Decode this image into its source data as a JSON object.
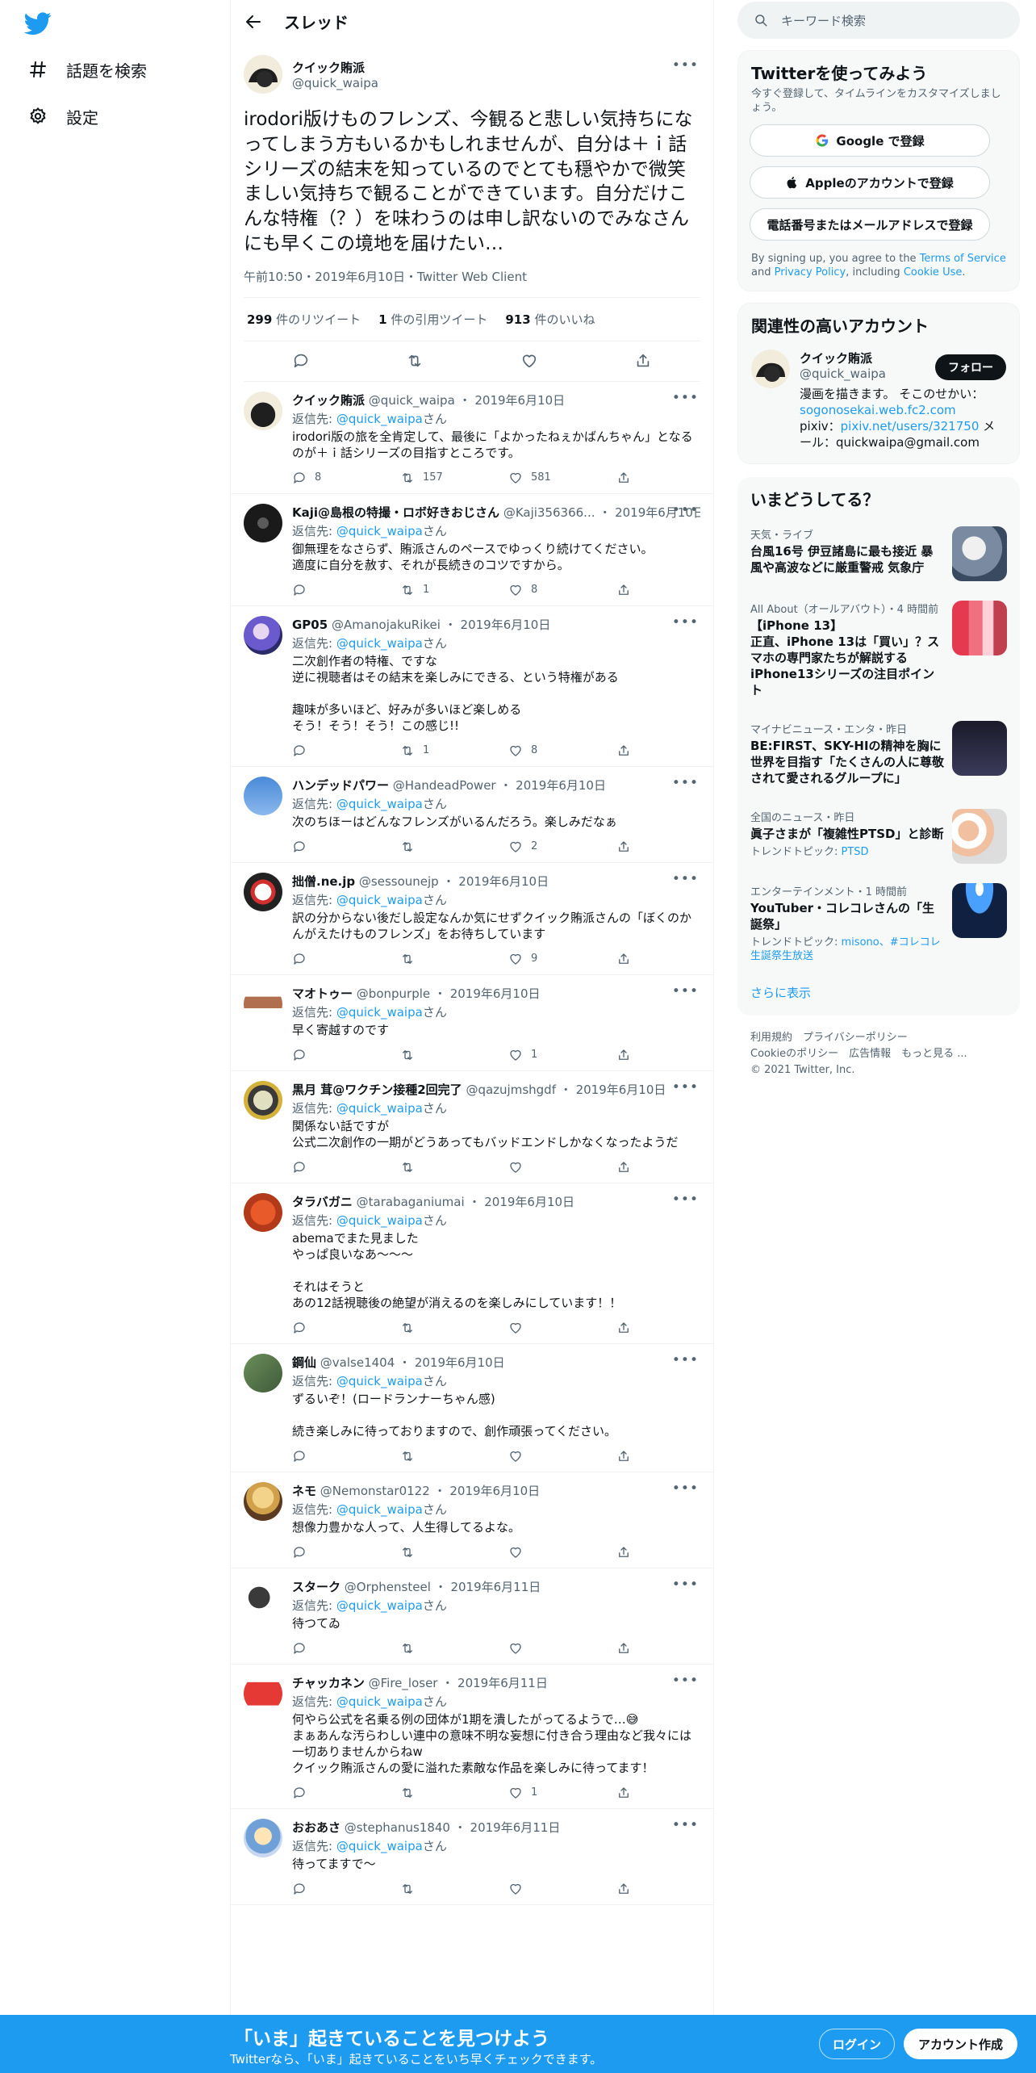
{
  "nav": {
    "explore_label": "話題を検索",
    "settings_label": "設定"
  },
  "header": {
    "title": "スレッド"
  },
  "main_tweet": {
    "name": "クイック賄派",
    "handle": "@quick_waipa",
    "text": "irodori版けものフレンズ、今観ると悲しい気持ちになってしまう方もいるかもしれませんが、自分は＋ｉ話シリーズの結末を知っているのでとても穏やかで微笑ましい気持ちで観ることができています。自分だけこんな特権（？）を味わうのは申し訳ないのでみなさんにも早くこの境地を届けたい…",
    "meta": "午前10:50・2019年6月10日・Twitter Web Client",
    "retweets": "299",
    "retweets_label": "件のリツイート",
    "quotes": "1",
    "quotes_label": "件の引用ツイート",
    "likes": "913",
    "likes_label": "件のいいね"
  },
  "replies": [
    {
      "name": "クイック賄派",
      "handle": "@quick_waipa",
      "date": "2019年6月10日",
      "replyto_label": "返信先:",
      "replyto": "@quick_waipa",
      "replyto_suffix": "さん",
      "text": "irodori版の旅を全肯定して、最後に「よかったねぇかばんちゃん」となるのが＋ｉ話シリーズの目指すところです。",
      "replies": "8",
      "retweets": "157",
      "likes": "581"
    },
    {
      "name": "Kaji@島根の特撮・ロボ好きおじさん",
      "handle": "@Kaji356366...",
      "date": "2019年6月10日",
      "replyto_label": "返信先:",
      "replyto": "@quick_waipa",
      "replyto_suffix": "さん",
      "text": "御無理をなさらず、賄派さんのペースでゆっくり続けてください。\n適度に自分を赦す、それが長続きのコツですから。",
      "replies": "",
      "retweets": "1",
      "likes": "8"
    },
    {
      "name": "GP05",
      "handle": "@AmanojakuRikei",
      "date": "2019年6月10日",
      "replyto_label": "返信先:",
      "replyto": "@quick_waipa",
      "replyto_suffix": "さん",
      "text": "二次創作者の特権、ですな\n逆に視聴者はその結末を楽しみにできる、という特権がある\n\n趣味が多いほど、好みが多いほど楽しめる\nそう！そう！そう！この感じ!!",
      "replies": "",
      "retweets": "1",
      "likes": "8"
    },
    {
      "name": "ハンデッドパワー",
      "handle": "@HandeadPower",
      "date": "2019年6月10日",
      "replyto_label": "返信先:",
      "replyto": "@quick_waipa",
      "replyto_suffix": "さん",
      "text": "次のちほーはどんなフレンズがいるんだろう。楽しみだなぁ",
      "replies": "",
      "retweets": "",
      "likes": "2"
    },
    {
      "name": "拙僧.ne.jp",
      "handle": "@sessounejp",
      "date": "2019年6月10日",
      "replyto_label": "返信先:",
      "replyto": "@quick_waipa",
      "replyto_suffix": "さん",
      "text": "訳の分からない後だし設定なんか気にせずクイック賄派さんの「ぼくのかんがえたけものフレンズ」をお待ちしています",
      "replies": "",
      "retweets": "",
      "likes": "9"
    },
    {
      "name": "マオトゥー",
      "handle": "@bonpurple",
      "date": "2019年6月10日",
      "replyto_label": "返信先:",
      "replyto": "@quick_waipa",
      "replyto_suffix": "さん",
      "text": "早く寄越すのです",
      "replies": "",
      "retweets": "",
      "likes": "1"
    },
    {
      "name": "黒月 茸@ワクチン接種2回完了",
      "handle": "@qazujmshgdf",
      "date": "2019年6月10日",
      "replyto_label": "返信先:",
      "replyto": "@quick_waipa",
      "replyto_suffix": "さん",
      "text": "関係ない話ですが\n公式二次創作の一期がどうあってもバッドエンドしかなくなったようだ",
      "replies": "",
      "retweets": "",
      "likes": ""
    },
    {
      "name": "タラバガニ",
      "handle": "@tarabaganiumai",
      "date": "2019年6月10日",
      "replyto_label": "返信先:",
      "replyto": "@quick_waipa",
      "replyto_suffix": "さん",
      "text": "abemaでまた見ました\nやっぱ良いなあ～～～\n\nそれはそうと\nあの12話視聴後の絶望が消えるのを楽しみにしています！！",
      "replies": "",
      "retweets": "",
      "likes": ""
    },
    {
      "name": "鋼仙",
      "handle": "@valse1404",
      "date": "2019年6月10日",
      "replyto_label": "返信先:",
      "replyto": "@quick_waipa",
      "replyto_suffix": "さん",
      "text": "ずるいぞ！(ロードランナーちゃん感)\n\n続き楽しみに待っておりますので、創作頑張ってください。",
      "replies": "",
      "retweets": "",
      "likes": ""
    },
    {
      "name": "ネモ",
      "handle": "@Nemonstar0122",
      "date": "2019年6月10日",
      "replyto_label": "返信先:",
      "replyto": "@quick_waipa",
      "replyto_suffix": "さん",
      "text": "想像力豊かな人って、人生得してるよな。",
      "replies": "",
      "retweets": "",
      "likes": ""
    },
    {
      "name": "スターク",
      "handle": "@Orphensteel",
      "date": "2019年6月11日",
      "replyto_label": "返信先:",
      "replyto": "@quick_waipa",
      "replyto_suffix": "さん",
      "text": "待つてゐ",
      "replies": "",
      "retweets": "",
      "likes": ""
    },
    {
      "name": "チャッカネン",
      "handle": "@Fire_loser",
      "date": "2019年6月11日",
      "replyto_label": "返信先:",
      "replyto": "@quick_waipa",
      "replyto_suffix": "さん",
      "text": "何やら公式を名乗る例の団体が1期を潰したがってるようで…😅\nまぁあんな汚らわしい連中の意味不明な妄想に付き合う理由など我々には一切ありませんからねw\nクイック賄派さんの愛に溢れた素敵な作品を楽しみに待ってます！",
      "replies": "",
      "retweets": "",
      "likes": "1"
    },
    {
      "name": "おおあさ",
      "handle": "@stephanus1840",
      "date": "2019年6月11日",
      "replyto_label": "返信先:",
      "replyto": "@quick_waipa",
      "replyto_suffix": "さん",
      "text": "待ってますで～",
      "replies": "",
      "retweets": "",
      "likes": ""
    }
  ],
  "search": {
    "placeholder": "キーワード検索"
  },
  "signup_card": {
    "title": "Twitterを使ってみよう",
    "subtitle": "今すぐ登録して、タイムラインをカスタマイズしましょう。",
    "google_label": "Google で登録",
    "apple_label": "Appleのアカウントで登録",
    "phone_label": "電話番号またはメールアドレスで登録",
    "terms_pre": "By signing up, you agree to the ",
    "terms_tos": "Terms of Service",
    "terms_and": " and ",
    "terms_privacy": "Privacy Policy",
    "terms_including": ", including ",
    "terms_cookie": "Cookie Use",
    "terms_end": "."
  },
  "related": {
    "title": "関連性の高いアカウント",
    "name": "クイック賄派",
    "handle": "@quick_waipa",
    "follow_label": "フォロー",
    "bio_1": "漫画を描きます。 そこのせかい：",
    "bio_link1": "sogonosekai.web.fc2.com",
    "bio_2": "pixiv：",
    "bio_link2": "pixiv.net/users/321750",
    "bio_3": " メール：quickwaipa@gmail.com"
  },
  "trends": {
    "title": "いまどうしてる？",
    "items": [
      {
        "meta": "天気・ライブ",
        "title": "台風16号 伊豆諸島に最も接近 暴風や高波などに厳重警戒 気象庁",
        "topic_label": "",
        "topic": ""
      },
      {
        "meta": "All About（オールアバウト）・4 時間前",
        "title": "【iPhone 13】\n正直、iPhone 13は「買い」？スマホの専門家たちが解説するiPhone13シリーズの注目ポイント",
        "topic_label": "",
        "topic": ""
      },
      {
        "meta": "マイナビニュース・エンタ・昨日",
        "title": "BE:FIRST、SKY-HIの精神を胸に世界を目指す「たくさんの人に尊敬されて愛されるグループに」",
        "topic_label": "",
        "topic": ""
      },
      {
        "meta": "全国のニュース・昨日",
        "title": "眞子さまが「複雑性PTSD」と診断",
        "topic_label": "トレンドトピック: ",
        "topic": "PTSD"
      },
      {
        "meta": "エンターテインメント・1 時間前",
        "title": "YouTuber・コレコレさんの「生誕祭」",
        "topic_label": "トレンドトピック: ",
        "topic": "misono、#コレコレ生誕祭生放送"
      }
    ],
    "show_more": "さらに表示"
  },
  "footer": {
    "line1": "利用規約　プライバシーポリシー",
    "line2": "Cookieのポリシー　広告情報　もっと見る ...",
    "line3": "© 2021 Twitter, Inc."
  },
  "bottom": {
    "headline": "「いま」起きていることを見つけよう",
    "subline": "Twitterなら、「いま」起きていることをいち早くチェックできます。",
    "login_label": "ログイン",
    "signup_label": "アカウント作成"
  },
  "colors": {
    "accent": "#1d9bf0",
    "text": "#0f1419",
    "muted": "#536471"
  }
}
